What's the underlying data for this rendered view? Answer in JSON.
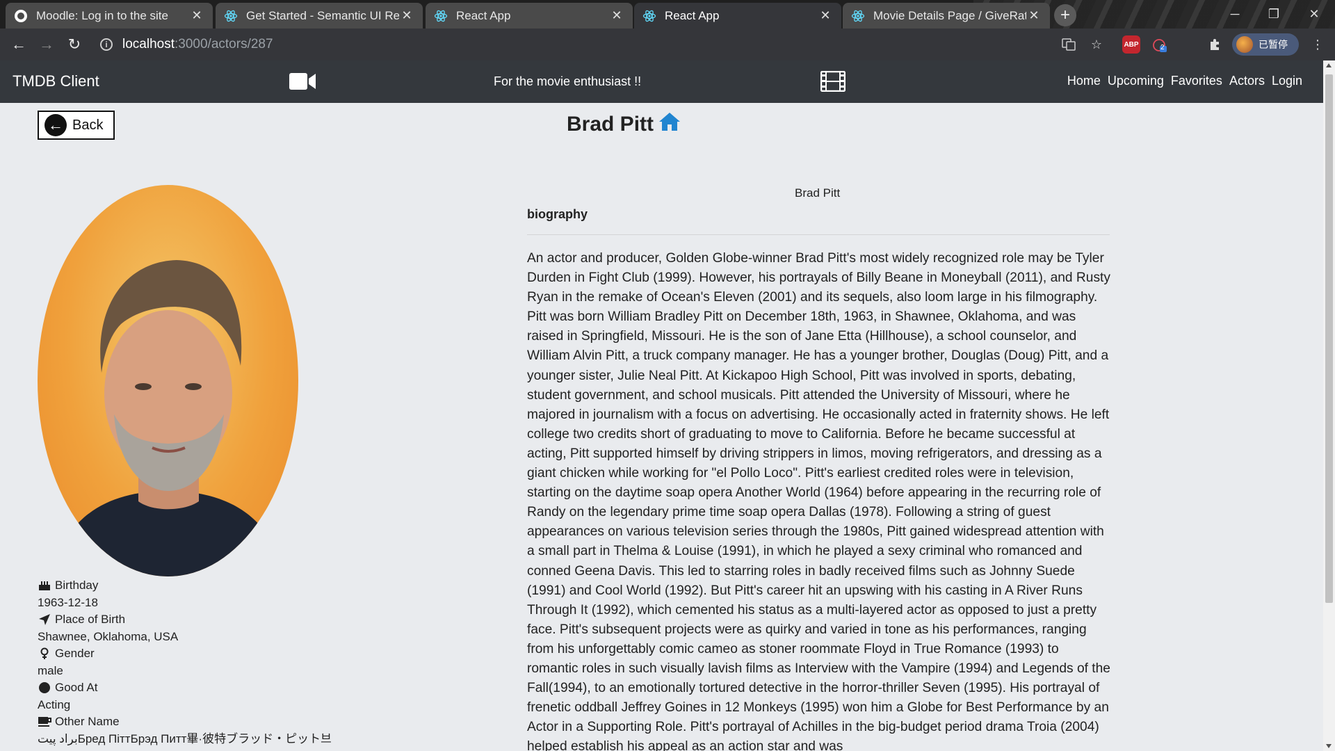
{
  "browser": {
    "tabs": [
      {
        "title": "Moodle: Log in to the site",
        "icon": "moodle-icon"
      },
      {
        "title": "Get Started - Semantic UI React",
        "icon": "react-icon"
      },
      {
        "title": "React App",
        "icon": "react-icon"
      },
      {
        "title": "React App",
        "icon": "react-icon",
        "active": true
      },
      {
        "title": "Movie Details Page / GiveRate",
        "icon": "react-icon"
      }
    ],
    "url_host": "localhost",
    "url_path": ":3000/actors/287",
    "profile_label": "已暂停",
    "extension_badge": "2",
    "abp_label": "ABP"
  },
  "navbar": {
    "brand": "TMDB Client",
    "tagline": "For the movie enthusiast !!",
    "links": [
      "Home",
      "Upcoming",
      "Favorites",
      "Actors",
      "Login"
    ]
  },
  "page": {
    "back_label": "Back",
    "title": "Brad Pitt",
    "actor_name": "Brad Pitt",
    "bio_heading": "biography",
    "biography": "An actor and producer, Golden Globe-winner Brad Pitt's most widely recognized role may be Tyler Durden in Fight Club (1999). However, his portrayals of Billy Beane in Moneyball (2011), and Rusty Ryan in the remake of Ocean's Eleven (2001) and its sequels, also loom large in his filmography. Pitt was born William Bradley Pitt on December 18th, 1963, in Shawnee, Oklahoma, and was raised in Springfield, Missouri. He is the son of Jane Etta (Hillhouse), a school counselor, and William Alvin Pitt, a truck company manager. He has a younger brother, Douglas (Doug) Pitt, and a younger sister, Julie Neal Pitt. At Kickapoo High School, Pitt was involved in sports, debating, student government, and school musicals. Pitt attended the University of Missouri, where he majored in journalism with a focus on advertising. He occasionally acted in fraternity shows. He left college two credits short of graduating to move to California. Before he became successful at acting, Pitt supported himself by driving strippers in limos, moving refrigerators, and dressing as a giant chicken while working for \"el Pollo Loco\". Pitt's earliest credited roles were in television, starting on the daytime soap opera Another World (1964) before appearing in the recurring role of Randy on the legendary prime time soap opera Dallas (1978). Following a string of guest appearances on various television series through the 1980s, Pitt gained widespread attention with a small part in Thelma & Louise (1991), in which he played a sexy criminal who romanced and conned Geena Davis. This led to starring roles in badly received films such as Johnny Suede (1991) and Cool World (1992). But Pitt's career hit an upswing with his casting in A River Runs Through It (1992), which cemented his status as a multi-layered actor as opposed to just a pretty face. Pitt's subsequent projects were as quirky and varied in tone as his performances, ranging from his unforgettably comic cameo as stoner roommate Floyd in True Romance (1993) to romantic roles in such visually lavish films as Interview with the Vampire (1994) and Legends of the Fall(1994), to an emotionally tortured detective in the horror-thriller Seven (1995). His portrayal of frenetic oddball Jeffrey Goines in 12 Monkeys (1995) won him a Globe for Best Performance by an Actor in a Supporting Role. Pitt's portrayal of Achilles in the big-budget period drama Troia (2004) helped establish his appeal as an action star and was",
    "details": {
      "birthday_label": "Birthday",
      "birthday": "1963-12-18",
      "birthplace_label": "Place of Birth",
      "birthplace": "Shawnee, Oklahoma, USA",
      "gender_label": "Gender",
      "gender": "male",
      "known_for_label": "Good At",
      "known_for": "Acting",
      "other_name_label": "Other Name",
      "other_names": "براد پیتБред ПіттБрэд Питт畢·彼特ブラッド・ピット브"
    }
  }
}
